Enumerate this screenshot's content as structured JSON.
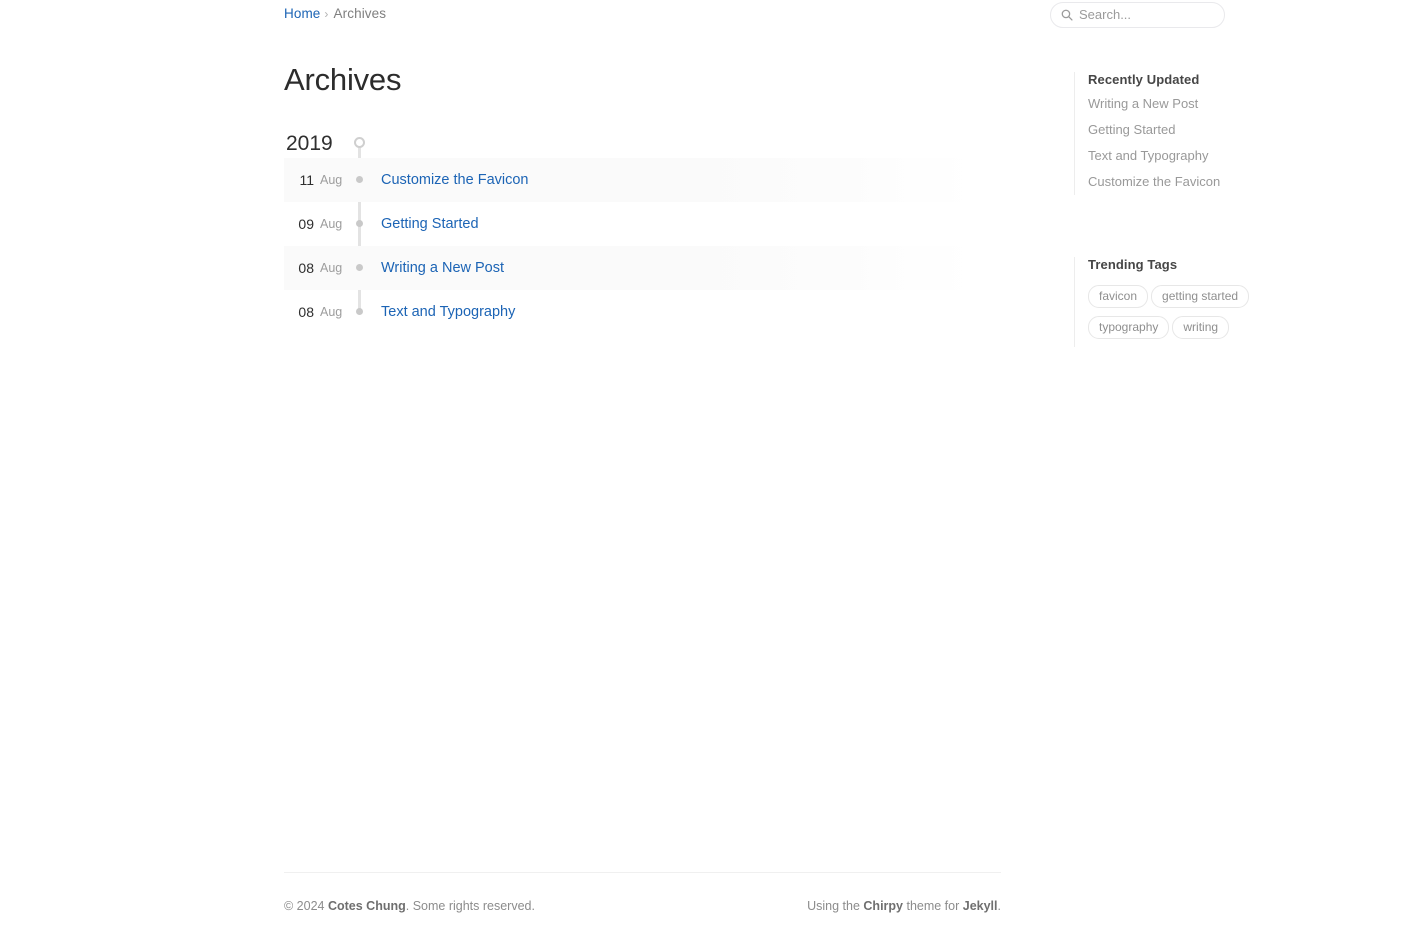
{
  "breadcrumb": {
    "home_label": "Home",
    "separator": "›",
    "current_label": "Archives"
  },
  "search": {
    "placeholder": "Search...",
    "value": "",
    "icon": "search-icon"
  },
  "page": {
    "title": "Archives"
  },
  "timeline": {
    "year": "2019",
    "posts": [
      {
        "day": "11",
        "month": "Aug",
        "title": "Customize the Favicon"
      },
      {
        "day": "09",
        "month": "Aug",
        "title": "Getting Started"
      },
      {
        "day": "08",
        "month": "Aug",
        "title": "Writing a New Post"
      },
      {
        "day": "08",
        "month": "Aug",
        "title": "Text and Typography"
      }
    ]
  },
  "sidebar": {
    "recently_updated": {
      "title": "Recently Updated",
      "items": [
        {
          "label": "Writing a New Post"
        },
        {
          "label": "Getting Started"
        },
        {
          "label": "Text and Typography"
        },
        {
          "label": "Customize the Favicon"
        }
      ]
    },
    "trending_tags": {
      "title": "Trending Tags",
      "tags": [
        {
          "label": "favicon"
        },
        {
          "label": "getting started"
        },
        {
          "label": "typography"
        },
        {
          "label": "writing"
        }
      ]
    }
  },
  "footer": {
    "copyright_prefix": "© 2024 ",
    "author": "Cotes Chung",
    "copyright_suffix": ". Some rights reserved.",
    "using_prefix": "Using the ",
    "theme_name": "Chirpy",
    "theme_mid": " theme for ",
    "engine_name": "Jekyll",
    "theme_suffix": "."
  },
  "colors": {
    "link": "#1c64b5",
    "muted": "#9d9d9d",
    "timeline_line": "#e3e3e3",
    "row_stripe": "#fafafa"
  }
}
